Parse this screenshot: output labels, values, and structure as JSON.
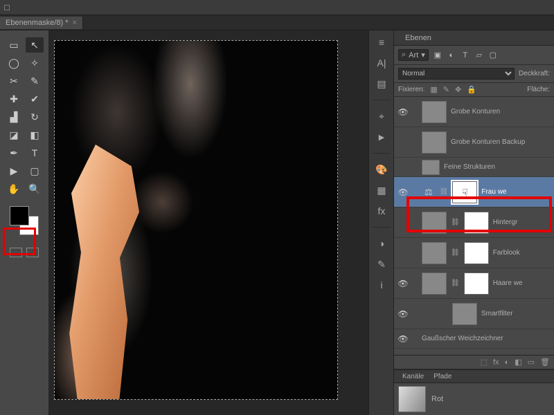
{
  "document": {
    "tab_title": "Ebenenmaske/8) *",
    "close_glyph": "×"
  },
  "panels": {
    "layers_tab": "Ebenen",
    "filter_prefix": "⌕",
    "filter_kind": "Art",
    "blend_mode": "Normal",
    "opacity_label": "Deckkraft:",
    "lock_label": "Fixieren:",
    "fill_label": "Fläche:"
  },
  "layers": [
    {
      "name": "Grobe Konturen",
      "eye": "👁",
      "thumb": "smoke"
    },
    {
      "name": "Grobe Konturen Backup",
      "eye": "",
      "thumb": "smoke"
    },
    {
      "name": "Feine Strukturen",
      "eye": "",
      "thumb": "smoke",
      "small": true
    },
    {
      "name": "Frau we",
      "eye": "👁",
      "selected": true,
      "balance": true,
      "mask": "maskportrait"
    },
    {
      "name": "Hintergr",
      "eye": "",
      "thumb": "chk",
      "mask": "maskportrait"
    },
    {
      "name": "Farblook",
      "eye": "",
      "thumb": "blue",
      "mask": "white"
    },
    {
      "name": "Haare we",
      "eye": "👁",
      "thumb": "photo",
      "mask": "maskportrait"
    },
    {
      "name": "Smartfilter",
      "eye": "👁",
      "thumb": "white",
      "indent": true,
      "small": false
    },
    {
      "name": "Gaußscher Weichzeichner",
      "eye": "👁",
      "text_only": true,
      "small": true
    }
  ],
  "channels": {
    "tab1": "Kanäle",
    "tab2": "Pfade",
    "item": "Rot"
  },
  "footer_icons": [
    "⬚",
    "fx",
    "◐",
    "◧",
    "▭",
    "🗑"
  ]
}
